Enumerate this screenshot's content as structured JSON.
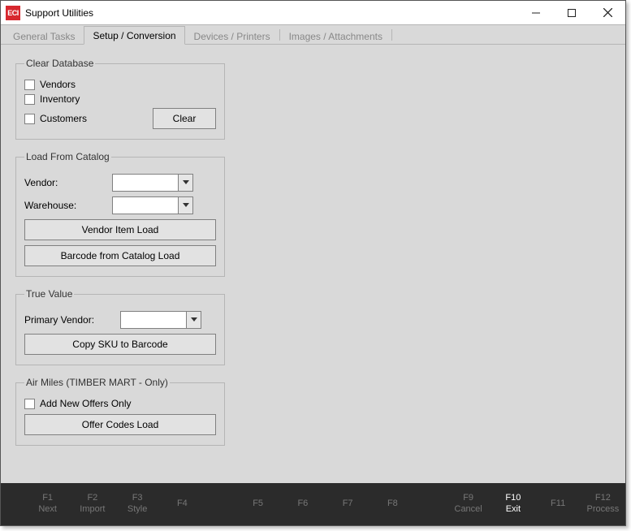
{
  "window": {
    "title": "Support Utilities",
    "icon_text": "ECI"
  },
  "tabs": [
    {
      "label": "General Tasks",
      "active": false
    },
    {
      "label": "Setup / Conversion",
      "active": true
    },
    {
      "label": "Devices / Printers",
      "active": false
    },
    {
      "label": "Images / Attachments",
      "active": false
    }
  ],
  "groups": {
    "clear_db": {
      "legend": "Clear Database",
      "vendors_label": "Vendors",
      "inventory_label": "Inventory",
      "customers_label": "Customers",
      "clear_button": "Clear"
    },
    "load_catalog": {
      "legend": "Load From Catalog",
      "vendor_label": "Vendor:",
      "warehouse_label": "Warehouse:",
      "vendor_item_load": "Vendor Item Load",
      "barcode_load": "Barcode from Catalog Load"
    },
    "true_value": {
      "legend": "True Value",
      "primary_vendor_label": "Primary Vendor:",
      "copy_sku": "Copy SKU to Barcode"
    },
    "air_miles": {
      "legend": "Air Miles (TIMBER MART - Only)",
      "add_new_only": "Add New Offers Only",
      "offer_codes_load": "Offer Codes Load"
    }
  },
  "footer": {
    "f1_key": "F1",
    "f1_label": "Next",
    "f2_key": "F2",
    "f2_label": "Import",
    "f3_key": "F3",
    "f3_label": "Style",
    "f4_key": "F4",
    "f4_label": "",
    "f5_key": "F5",
    "f5_label": "",
    "f6_key": "F6",
    "f6_label": "",
    "f7_key": "F7",
    "f7_label": "",
    "f8_key": "F8",
    "f8_label": "",
    "f9_key": "F9",
    "f9_label": "Cancel",
    "f10_key": "F10",
    "f10_label": "Exit",
    "f11_key": "F11",
    "f11_label": "",
    "f12_key": "F12",
    "f12_label": "Process"
  }
}
